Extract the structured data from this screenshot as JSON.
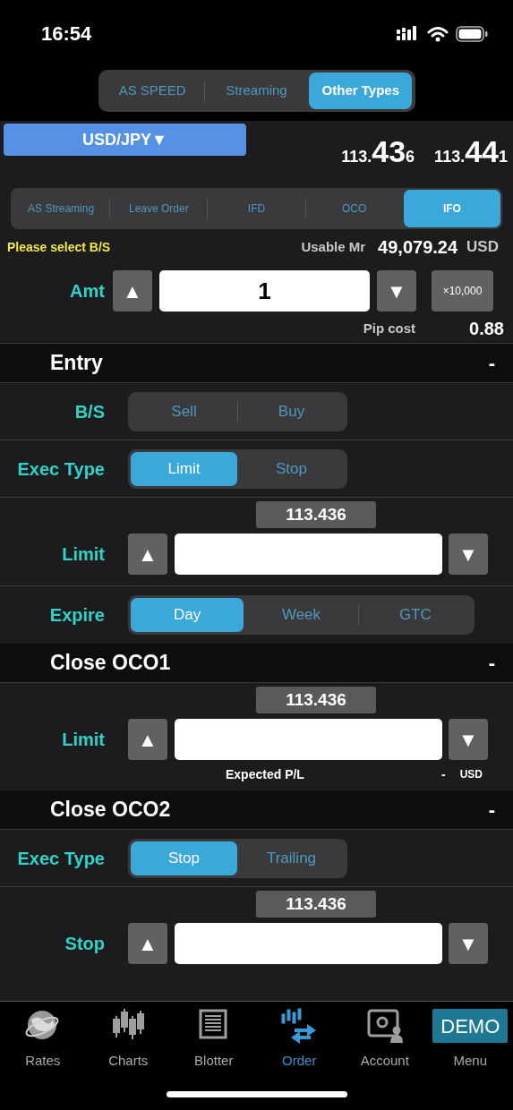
{
  "status_bar": {
    "time": "16:54"
  },
  "mode_tabs": [
    {
      "label": "AS SPEED",
      "selected": false
    },
    {
      "label": "Streaming",
      "selected": false
    },
    {
      "label": "Other Types",
      "selected": true
    }
  ],
  "symbol": {
    "label": "USD/JPY▼"
  },
  "prices": [
    {
      "prefix": "113.",
      "big": "43",
      "small": "6"
    },
    {
      "prefix": "113.",
      "big": "44",
      "small": "1"
    }
  ],
  "order_tabs": [
    {
      "label": "AS Streaming",
      "selected": false
    },
    {
      "label": "Leave Order",
      "selected": false
    },
    {
      "label": "IFD",
      "selected": false
    },
    {
      "label": "OCO",
      "selected": false
    },
    {
      "label": "IFO",
      "selected": true
    }
  ],
  "notice": "Please select B/S",
  "usable": {
    "label": "Usable Mr",
    "value": "49,079.24",
    "currency": "USD"
  },
  "amount": {
    "label": "Amt",
    "up": "▲",
    "value": "1",
    "down": "▼",
    "multiplier": "×10,000",
    "pip_label": "Pip cost",
    "pip_value": "0.88"
  },
  "sections": [
    {
      "title": "Entry",
      "toggle": "-",
      "rows": [
        {
          "kind": "segmented",
          "label": "B/S",
          "options": [
            {
              "label": "Sell",
              "selected": false
            },
            {
              "label": "Buy",
              "selected": false
            }
          ]
        },
        {
          "kind": "segmented",
          "label": "Exec Type",
          "options": [
            {
              "label": "Limit",
              "selected": true
            },
            {
              "label": "Stop",
              "selected": false
            }
          ]
        },
        {
          "kind": "price",
          "label": "Limit",
          "tag": "113.436",
          "up": "▲",
          "down": "▼"
        },
        {
          "kind": "segmented",
          "label": "Expire",
          "options": [
            {
              "label": "Day",
              "selected": true
            },
            {
              "label": "Week",
              "selected": false
            },
            {
              "label": "GTC",
              "selected": false
            }
          ]
        }
      ]
    },
    {
      "title": "Close OCO1",
      "toggle": "-",
      "rows": [
        {
          "kind": "price",
          "label": "Limit",
          "tag": "113.436",
          "up": "▲",
          "down": "▼",
          "expected": {
            "label": "Expected P/L",
            "value": "-",
            "currency": "USD"
          }
        }
      ]
    },
    {
      "title": "Close OCO2",
      "toggle": "-",
      "rows": [
        {
          "kind": "segmented",
          "label": "Exec Type",
          "options": [
            {
              "label": "Stop",
              "selected": true
            },
            {
              "label": "Trailing",
              "selected": false
            }
          ]
        },
        {
          "kind": "price",
          "label": "Stop",
          "tag": "113.436",
          "up": "▲",
          "down": "▼"
        }
      ]
    }
  ],
  "tab_bar": [
    {
      "label": "Rates",
      "selected": false
    },
    {
      "label": "Charts",
      "selected": false
    },
    {
      "label": "Blotter",
      "selected": false
    },
    {
      "label": "Order",
      "selected": true
    },
    {
      "label": "Account",
      "selected": false
    },
    {
      "label": "Menu",
      "selected": false
    }
  ],
  "demo_badge": "DEMO"
}
